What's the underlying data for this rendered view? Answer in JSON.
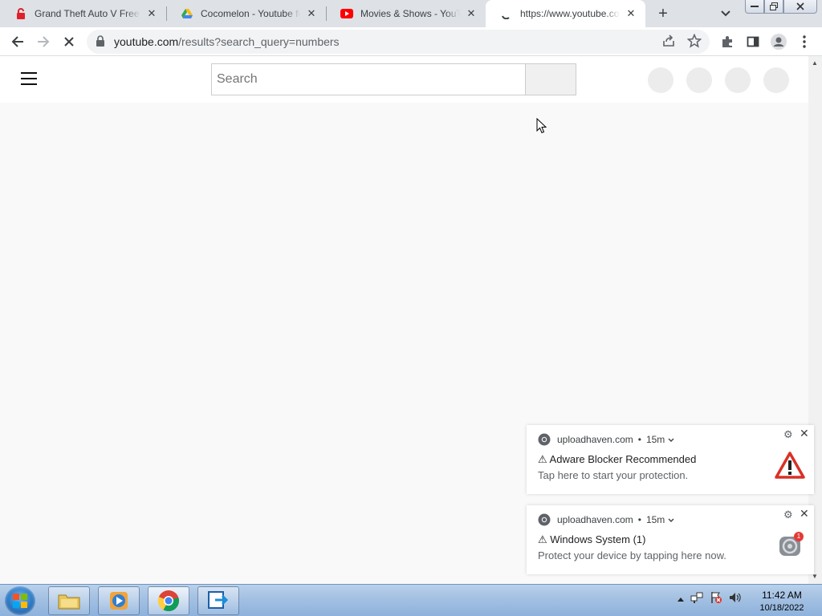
{
  "browser": {
    "tabs": [
      {
        "title": "Grand Theft Auto V Free D",
        "favicon": "red-lock-icon"
      },
      {
        "title": "Cocomelon - Youtube for K",
        "favicon": "drive-icon"
      },
      {
        "title": "Movies & Shows - YouTube",
        "favicon": "youtube-icon"
      },
      {
        "title": "https://www.youtube.com/",
        "favicon": "loading-icon",
        "active": true
      }
    ],
    "new_tab_label": "+",
    "address": {
      "domain": "youtube.com",
      "path": "/results?search_query=numbers"
    }
  },
  "youtube": {
    "search_placeholder": "Search"
  },
  "notifications": [
    {
      "source": "uploadhaven.com",
      "time": "15m",
      "title": "⚠ Adware Blocker Recommended",
      "body": "Tap here to start your protection.",
      "image": "warning-triangle-icon"
    },
    {
      "source": "uploadhaven.com",
      "time": "15m",
      "title": "⚠ Windows System (1)",
      "body": "Protect your device by tapping here now.",
      "image": "system-settings-icon",
      "badge": "1"
    }
  ],
  "taskbar": {
    "time": "11:42 AM",
    "date": "10/18/2022"
  },
  "colors": {
    "tabstrip": "#dee1e6",
    "taskbar": "#a3c0e2",
    "youtube_red": "#ff0000"
  }
}
